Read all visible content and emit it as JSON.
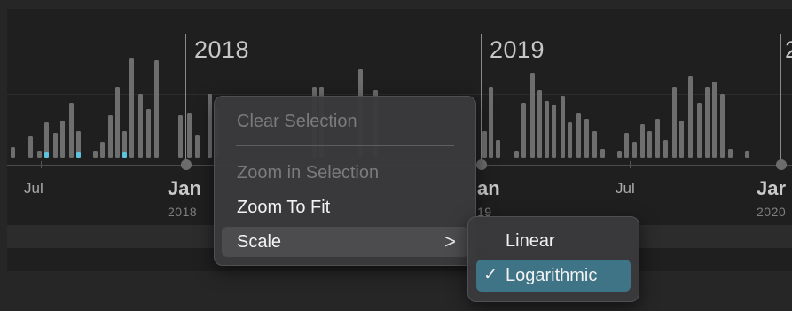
{
  "timeline": {
    "years": [
      "2018",
      "2019",
      "2"
    ],
    "ticks": {
      "jul_1": "Jul",
      "jan_2018": "Jan",
      "jan_2018_year": "2018",
      "jan_2019": "an",
      "jan_2019_year": "19",
      "jul_2": "Jul",
      "jan_2020": "Jar",
      "jan_2020_year": "2020"
    }
  },
  "context_menu": {
    "clear_selection": "Clear Selection",
    "zoom_in_selection": "Zoom in Selection",
    "zoom_to_fit": "Zoom To Fit",
    "scale": "Scale",
    "scale_chevron": ">"
  },
  "scale_submenu": {
    "linear": "Linear",
    "logarithmic": "Logarithmic",
    "checkmark": "✓",
    "selected": "Logarithmic"
  },
  "colors": {
    "bar": "#6e6e6e",
    "highlight_bar": "#5ec3dc",
    "selected_item": "#3f7386"
  }
}
